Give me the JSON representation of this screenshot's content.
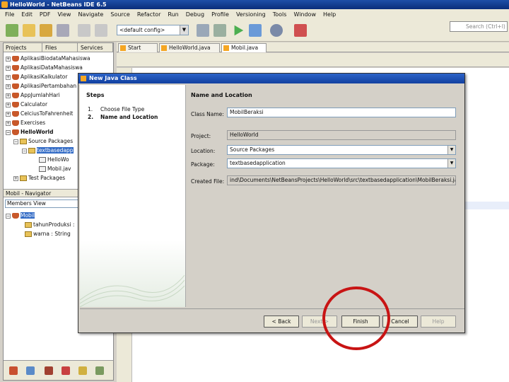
{
  "window": {
    "title": "HelloWorld - NetBeans IDE 6.5"
  },
  "menu": [
    "File",
    "Edit",
    "PDF",
    "View",
    "Navigate",
    "Source",
    "Refactor",
    "Run",
    "Debug",
    "Profile",
    "Versioning",
    "Tools",
    "Window",
    "Help"
  ],
  "toolbar": {
    "config_value": "<default config>",
    "search_placeholder": "Search (Ctrl+I)"
  },
  "projects_panel": {
    "tabs": [
      "Projects",
      "Files",
      "Services"
    ],
    "tree": [
      "AplikasiBiodataMahasiswa",
      "AplikasiDataMahasiswa",
      "AplikasiKalkulator",
      "AplikasiPertambahan",
      "AppJumlahHari",
      "Calculator",
      "CelciusToFahrenheit",
      "Exercises",
      "HelloWorld",
      "Source Packages",
      "textbasedapp",
      "HelloWo",
      "Mobil.jav",
      "Test Packages"
    ]
  },
  "navigator": {
    "title": "Mobil - Navigator",
    "view": "Members View",
    "items": [
      "Mobil",
      "tahunProduksi : ",
      "warna : String"
    ]
  },
  "editor": {
    "tabs": [
      "Start Page",
      "HelloWorld.java",
      "Mobil.java"
    ]
  },
  "dialog": {
    "title": "New Java Class",
    "steps_title": "Steps",
    "steps": [
      {
        "num": "1.",
        "label": "Choose File Type"
      },
      {
        "num": "2.",
        "label": "Name and Location"
      }
    ],
    "section_title": "Name and Location",
    "fields": {
      "class_name_label": "Class Name:",
      "class_name_value": "MobilBeraksi",
      "project_label": "Project:",
      "project_value": "HelloWorld",
      "location_label": "Location:",
      "location_value": "Source Packages",
      "package_label": "Package:",
      "package_value": "textbasedapplication",
      "created_file_label": "Created File:",
      "created_file_value": "ind\\Documents\\NetBeansProjects\\HelloWorld\\src\\textbasedapplication\\MobilBeraksi.java"
    },
    "buttons": {
      "back": "< Back",
      "next": "Next >",
      "finish": "Finish",
      "cancel": "Cancel",
      "help": "Help"
    }
  },
  "colors": {
    "annotation_circle": "#c81414",
    "title_bar": "#1240a0",
    "selection": "#316ac5"
  }
}
